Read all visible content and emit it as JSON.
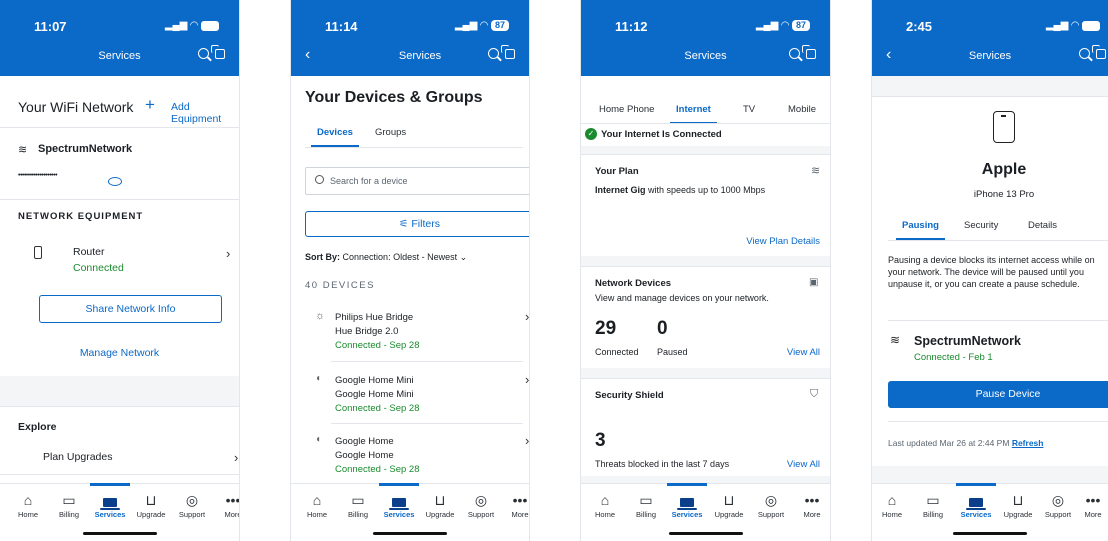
{
  "screens": [
    {
      "status_time": "11:07",
      "header_title": "Services",
      "title": "Your WiFi Network",
      "add_equipment": "Add Equipment",
      "network_name": "SpectrumNetwork",
      "password_mask": "••••••••••••••••••••",
      "section_label": "NETWORK EQUIPMENT",
      "device_name": "Router",
      "device_status": "Connected",
      "share_button": "Share Network Info",
      "manage_link": "Manage Network",
      "explore_label": "Explore",
      "plan_upgrades": "Plan Upgrades"
    },
    {
      "status_time": "11:14",
      "battery": "87",
      "header_title": "Services",
      "title": "Your Devices & Groups",
      "tabs": [
        "Devices",
        "Groups"
      ],
      "search_placeholder": "Search for a device",
      "filters_button": "Filters",
      "sort_label": "Sort By:",
      "sort_value": "Connection: Oldest - Newest",
      "count_label": "40 DEVICES",
      "devices": [
        {
          "name": "Philips Hue Bridge",
          "model": "Hue Bridge 2.0",
          "status": "Connected - Sep 28"
        },
        {
          "name": "Google Home Mini",
          "model": "Google Home Mini",
          "status": "Connected - Sep 28"
        },
        {
          "name": "Google Home",
          "model": "Google Home",
          "status": "Connected - Sep 28"
        }
      ]
    },
    {
      "status_time": "11:12",
      "battery": "87",
      "header_title": "Services",
      "tabs": [
        "Home Phone",
        "Internet",
        "TV",
        "Mobile"
      ],
      "connected_banner": "Your Internet Is Connected",
      "plan_title": "Your Plan",
      "plan_name": "Internet Gig",
      "plan_desc": "with speeds up to 1000 Mbps",
      "plan_link": "View Plan Details",
      "devices_title": "Network Devices",
      "devices_desc": "View and manage devices on your network.",
      "connected_count": "29",
      "connected_label": "Connected",
      "paused_count": "0",
      "paused_label": "Paused",
      "view_all": "View All",
      "shield_title": "Security Shield",
      "threats_count": "3",
      "threats_label": "Threats blocked in the last 7 days",
      "view_all_2": "View All"
    },
    {
      "status_time": "2:45",
      "header_title": "Services",
      "device_brand": "Apple",
      "device_model": "iPhone 13 Pro",
      "tabs": [
        "Pausing",
        "Security",
        "Details"
      ],
      "pausing_text": "Pausing a device blocks its internet access while on your network. The device will be paused until you unpause it, or you can create a pause schedule.",
      "network_name": "SpectrumNetwork",
      "network_status": "Connected - Feb 1",
      "pause_button": "Pause Device",
      "last_updated": "Last updated Mar 26 at 2:44 PM",
      "refresh_link": "Refresh"
    }
  ],
  "bottom_nav": [
    "Home",
    "Billing",
    "Services",
    "Upgrade",
    "Support",
    "More"
  ],
  "icons": {
    "home": "home-icon",
    "billing": "bill-icon",
    "services": "laptop-icon",
    "upgrade": "cart-icon",
    "support": "support-icon",
    "more": "more-icon"
  },
  "colors": {
    "brand_blue": "#0b69c7",
    "connected_green": "#1a8a2e"
  }
}
